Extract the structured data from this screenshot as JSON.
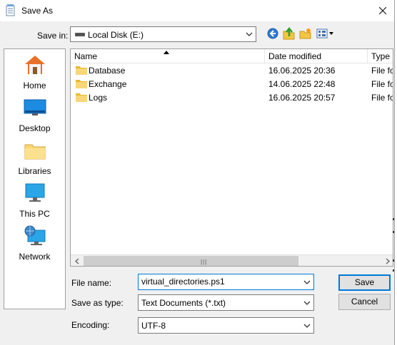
{
  "window": {
    "title": "Save As"
  },
  "save_in": {
    "label": "Save in:",
    "value": "Local Disk (E:)"
  },
  "toolbar": {
    "back_icon": "back-arrow-icon",
    "up_icon": "up-folder-icon",
    "new_folder_icon": "new-folder-icon",
    "view_icon": "view-menu-icon"
  },
  "places": [
    {
      "label": "Home",
      "icon": "home-icon"
    },
    {
      "label": "Desktop",
      "icon": "desktop-icon"
    },
    {
      "label": "Libraries",
      "icon": "libraries-icon"
    },
    {
      "label": "This PC",
      "icon": "this-pc-icon"
    },
    {
      "label": "Network",
      "icon": "network-icon"
    }
  ],
  "columns": {
    "name": "Name",
    "date_modified": "Date modified",
    "type": "Type"
  },
  "files": [
    {
      "name": "Database",
      "date_modified": "16.06.2025 20:36",
      "type": "File fo"
    },
    {
      "name": "Exchange",
      "date_modified": "14.06.2025 22:48",
      "type": "File fo"
    },
    {
      "name": "Logs",
      "date_modified": "16.06.2025 20:57",
      "type": "File fo"
    }
  ],
  "form": {
    "file_name_label": "File name:",
    "file_name_value": "virtual_directories.ps1",
    "save_as_type_label": "Save as type:",
    "save_as_type_value": "Text Documents (*.txt)",
    "encoding_label": "Encoding:",
    "encoding_value": "UTF-8"
  },
  "buttons": {
    "save": "Save",
    "cancel": "Cancel"
  },
  "colors": {
    "accent": "#0078d7",
    "folder": "#f8d775",
    "selection": "#cce8ff"
  }
}
